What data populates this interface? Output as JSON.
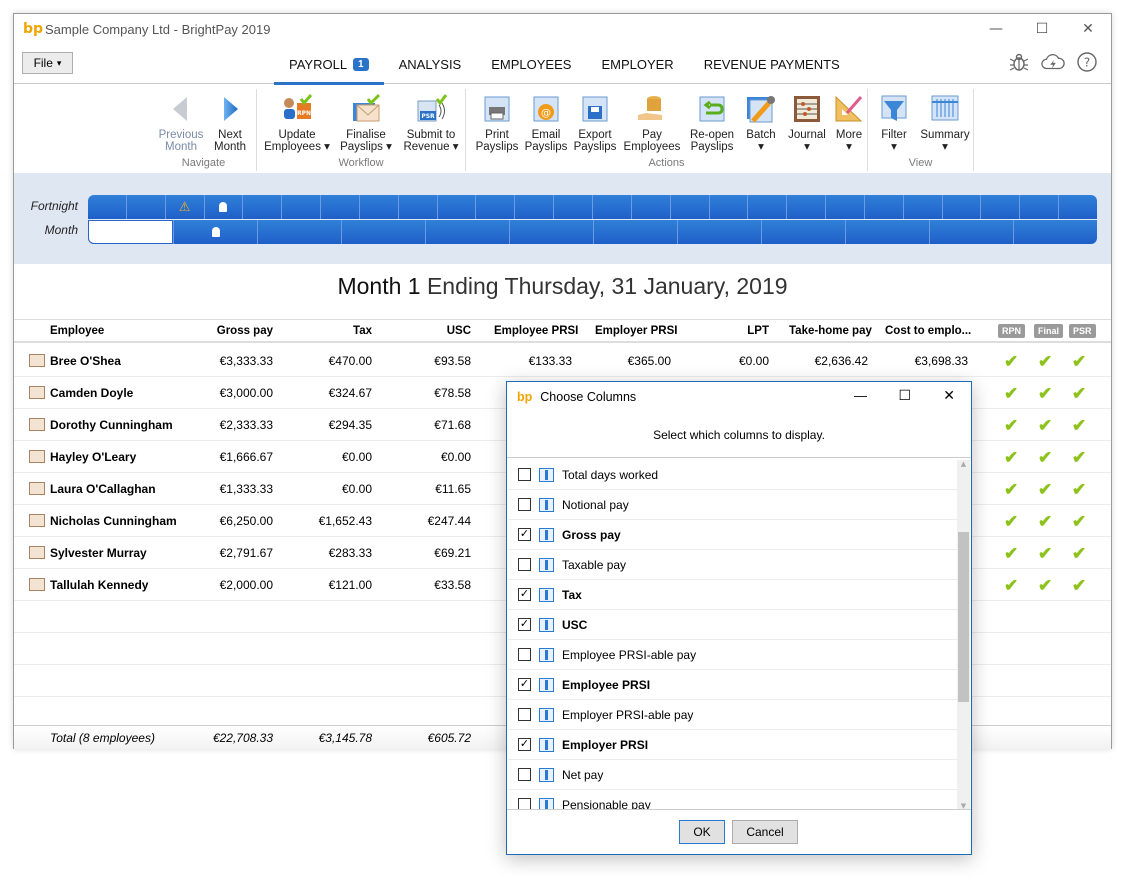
{
  "window": {
    "title": "Sample Company Ltd - BrightPay 2019",
    "logo": "bp",
    "controls": {
      "minimize": "—",
      "maximize": "☐",
      "close": "✕"
    }
  },
  "menubar": {
    "file_label": "File",
    "file_arrow": "▾",
    "tabs": [
      {
        "label": "PAYROLL",
        "badge": "1",
        "active": true
      },
      {
        "label": "ANALYSIS"
      },
      {
        "label": "EMPLOYEES"
      },
      {
        "label": "EMPLOYER"
      },
      {
        "label": "REVENUE PAYMENTS"
      }
    ],
    "right_icons": [
      "bug-icon",
      "cloud-icon",
      "help-icon"
    ]
  },
  "ribbon": {
    "groups": [
      {
        "label": "Navigate",
        "buttons": [
          {
            "line1": "Previous",
            "line2": "Month",
            "icon": "arrow-left-icon",
            "disabled": true
          },
          {
            "line1": "Next",
            "line2": "Month",
            "icon": "arrow-right-icon"
          }
        ]
      },
      {
        "label": "Workflow",
        "buttons": [
          {
            "line1": "Update",
            "line2": "Employees ▾",
            "icon": "update-employees-icon"
          },
          {
            "line1": "Finalise",
            "line2": "Payslips ▾",
            "icon": "finalise-payslips-icon"
          },
          {
            "line1": "Submit to",
            "line2": "Revenue ▾",
            "icon": "submit-revenue-icon"
          }
        ]
      },
      {
        "label": "Actions",
        "buttons": [
          {
            "line1": "Print",
            "line2": "Payslips",
            "icon": "print-icon"
          },
          {
            "line1": "Email",
            "line2": "Payslips",
            "icon": "email-icon"
          },
          {
            "line1": "Export",
            "line2": "Payslips",
            "icon": "export-icon"
          },
          {
            "line1": "Pay",
            "line2": "Employees",
            "icon": "pay-icon"
          },
          {
            "line1": "Re-open",
            "line2": "Payslips",
            "icon": "reopen-icon"
          },
          {
            "line1": "Batch",
            "line2": "▾",
            "icon": "batch-icon"
          },
          {
            "line1": "Journal",
            "line2": "▾",
            "icon": "journal-icon"
          },
          {
            "line1": "More",
            "line2": "▾",
            "icon": "more-icon"
          }
        ]
      },
      {
        "label": "View",
        "buttons": [
          {
            "line1": "Filter",
            "line2": "▾",
            "icon": "filter-icon"
          },
          {
            "line1": "Summary",
            "line2": "▾",
            "icon": "summary-icon"
          }
        ]
      }
    ]
  },
  "periods": {
    "fortnight_label": "Fortnight",
    "month_label": "Month",
    "fortnight_count": 26,
    "month_count": 12,
    "warning_glyph": "⚠",
    "person_glyph": "👤"
  },
  "heading": {
    "period": "Month 1",
    "ending": "Ending Thursday, 31 January, 2019"
  },
  "table": {
    "headers": {
      "employee": "Employee",
      "gross": "Gross pay",
      "tax": "Tax",
      "usc": "USC",
      "ee_prsi": "Employee PRSI",
      "er_prsi": "Employer PRSI",
      "lpt": "LPT",
      "takehome": "Take-home pay",
      "cost": "Cost to emplo...",
      "rpn": "RPN",
      "final": "Final",
      "psr": "PSR"
    },
    "rows": [
      {
        "name": "Bree O'Shea",
        "gross": "€3,333.33",
        "tax": "€470.00",
        "usc": "€93.58",
        "ee_prsi": "€133.33",
        "er_prsi": "€365.00",
        "lpt": "€0.00",
        "takehome": "€2,636.42",
        "cost": "€3,698.33"
      },
      {
        "name": "Camden Doyle",
        "gross": "€3,000.00",
        "tax": "€324.67",
        "usc": "€78.58"
      },
      {
        "name": "Dorothy Cunningham",
        "gross": "€2,333.33",
        "tax": "€294.35",
        "usc": "€71.68"
      },
      {
        "name": "Hayley O'Leary",
        "gross": "€1,666.67",
        "tax": "€0.00",
        "usc": "€0.00"
      },
      {
        "name": "Laura O'Callaghan",
        "gross": "€1,333.33",
        "tax": "€0.00",
        "usc": "€11.65"
      },
      {
        "name": "Nicholas Cunningham",
        "gross": "€6,250.00",
        "tax": "€1,652.43",
        "usc": "€247.44"
      },
      {
        "name": "Sylvester Murray",
        "gross": "€2,791.67",
        "tax": "€283.33",
        "usc": "€69.21"
      },
      {
        "name": "Tallulah Kennedy",
        "gross": "€2,000.00",
        "tax": "€121.00",
        "usc": "€33.58"
      }
    ],
    "check_glyph": "✔",
    "total": {
      "label": "Total (8 employees)",
      "gross": "€22,708.33",
      "tax": "€3,145.78",
      "usc": "€605.72"
    }
  },
  "dialog": {
    "title": "Choose Columns",
    "subtitle": "Select which columns to display.",
    "items": [
      {
        "label": "Total days worked",
        "checked": false
      },
      {
        "label": "Notional pay",
        "checked": false
      },
      {
        "label": "Gross pay",
        "checked": true
      },
      {
        "label": "Taxable pay",
        "checked": false
      },
      {
        "label": "Tax",
        "checked": true
      },
      {
        "label": "USC",
        "checked": true
      },
      {
        "label": "Employee PRSI-able pay",
        "checked": false
      },
      {
        "label": "Employee PRSI",
        "checked": true
      },
      {
        "label": "Employer PRSI-able pay",
        "checked": false
      },
      {
        "label": "Employer PRSI",
        "checked": true
      },
      {
        "label": "Net pay",
        "checked": false
      },
      {
        "label": "Pensionable pay",
        "checked": false
      }
    ],
    "ok_label": "OK",
    "cancel_label": "Cancel"
  }
}
